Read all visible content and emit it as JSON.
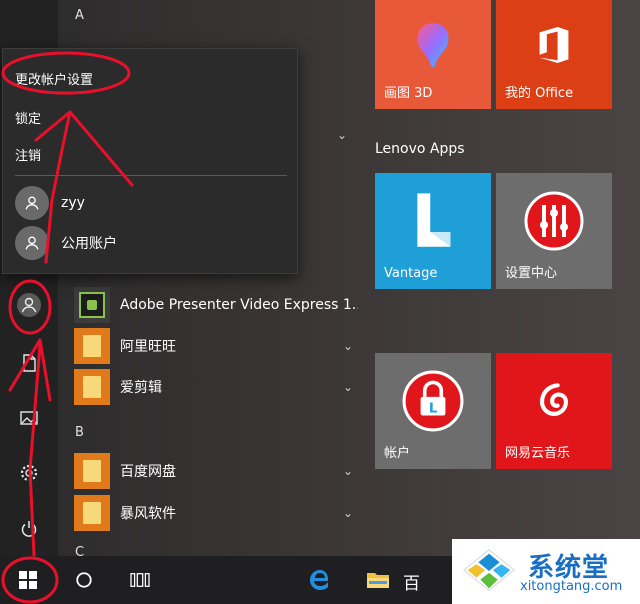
{
  "app_list": {
    "letters": {
      "a": "A",
      "b": "B",
      "c": "C"
    },
    "apps": [
      {
        "name": "Adobe Presenter Video Express 1..."
      },
      {
        "name": "阿里旺旺"
      },
      {
        "name": "爱剪辑"
      },
      {
        "name": "百度网盘"
      },
      {
        "name": "暴风软件"
      }
    ]
  },
  "account_flyout": {
    "change_settings": "更改帐户设置",
    "lock": "锁定",
    "sign_out": "注销",
    "users": [
      {
        "name": "zyy"
      },
      {
        "name": "公用账户"
      }
    ]
  },
  "tiles": {
    "paint3d": {
      "label": "画图 3D",
      "color": "#e8593a"
    },
    "office": {
      "label": "我的 Office",
      "color": "#dc3e15"
    },
    "group_title": "Lenovo Apps",
    "vantage": {
      "label": "Vantage",
      "color": "#1e9fd8"
    },
    "settings_center": {
      "label": "设置中心",
      "color": "#6d6d6d"
    },
    "account": {
      "label": "帐户",
      "color": "#6d6d6d"
    },
    "netease_music": {
      "label": "网易云音乐",
      "color": "#e1161b"
    }
  },
  "taskbar": {
    "pinned_label_fragment": "百"
  },
  "watermark": {
    "title": "系统堂",
    "url": "xitongtang.com"
  },
  "colors": {
    "annotation": "#e8102a",
    "accent_blue": "#1a6fc4"
  },
  "icons": {
    "rail": [
      "user-icon",
      "document-icon",
      "pictures-icon",
      "settings-gear-icon",
      "power-icon"
    ],
    "taskbar": [
      "windows-start-icon",
      "cortana-circle-icon",
      "task-view-icon",
      "edge-icon",
      "file-explorer-icon"
    ]
  }
}
